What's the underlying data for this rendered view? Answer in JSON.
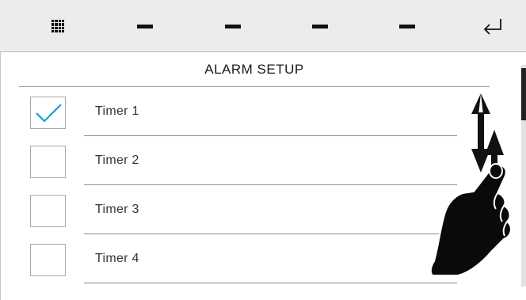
{
  "header": {
    "icons": [
      "menu-grid-icon",
      "dash-icon",
      "dash-icon",
      "dash-icon",
      "dash-icon",
      "enter-return-icon"
    ]
  },
  "title": "ALARM SETUP",
  "timers": [
    {
      "label": "Timer 1",
      "checked": true
    },
    {
      "label": "Timer 2",
      "checked": false
    },
    {
      "label": "Timer 3",
      "checked": false
    },
    {
      "label": "Timer 4",
      "checked": false
    }
  ],
  "colors": {
    "header_bg": "#ececec",
    "check_accent": "#1e9bd7",
    "text": "#333333",
    "divider": "#8c8c8c"
  },
  "gesture_icon": "swipe-scroll-hand-icon"
}
